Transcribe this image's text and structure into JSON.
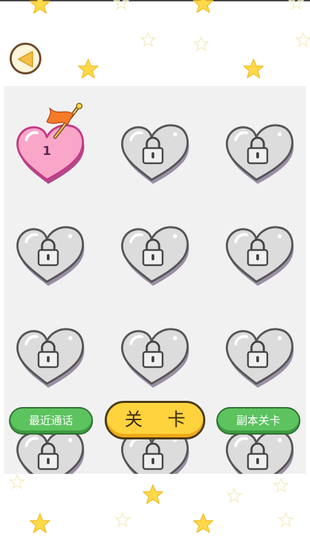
{
  "header": {
    "back_icon": "back-arrow-icon"
  },
  "levels": [
    {
      "number": "1",
      "state": "unlocked",
      "current": true,
      "color": "#f9a6c9"
    },
    {
      "state": "locked"
    },
    {
      "state": "locked"
    },
    {
      "state": "locked"
    },
    {
      "state": "locked"
    },
    {
      "state": "locked"
    },
    {
      "state": "locked"
    },
    {
      "state": "locked"
    },
    {
      "state": "locked"
    },
    {
      "state": "locked"
    },
    {
      "state": "locked"
    },
    {
      "state": "locked"
    }
  ],
  "bottom_bar": {
    "left_label": "最近通话",
    "center_label": "关 卡",
    "right_label": "副本关卡"
  },
  "colors": {
    "green_button": "#5cc35f",
    "yellow_button": "#ffd33d",
    "locked_heart": "#d9d9d9",
    "star": "#ffd94a",
    "flag": "#f57a28"
  }
}
